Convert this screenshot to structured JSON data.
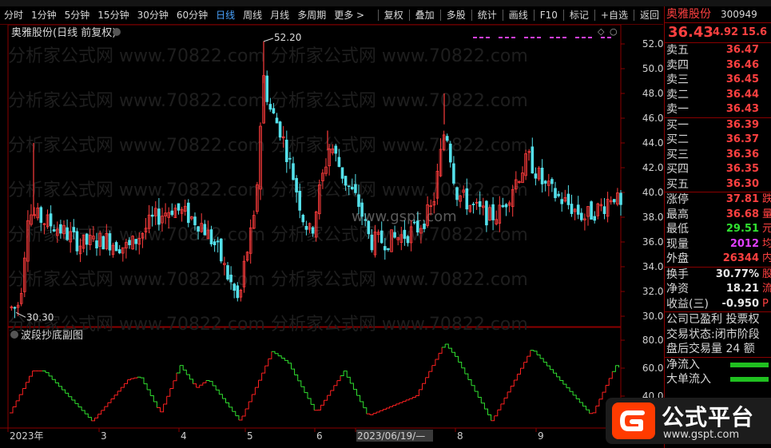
{
  "toolbar": {
    "periods": [
      "分时",
      "1分钟",
      "5分钟",
      "15分钟",
      "30分钟",
      "60分钟",
      "日线",
      "周线",
      "月线",
      "多周期",
      "更多 >"
    ],
    "active_period": "日线",
    "actions": [
      "复权",
      "叠加",
      "多股",
      "统计",
      "画线",
      "F10",
      "标记",
      "+自选",
      "返回"
    ]
  },
  "chart": {
    "title": "奥雅股份(日线 前复权)",
    "high_marker": "52.20",
    "low_marker": "30.30",
    "watermark": "www.gspt.com",
    "watermark2": "分析家公式网 www.70822.com",
    "y_ticks": [
      "52.00",
      "50.00",
      "48.00",
      "46.00",
      "44.00",
      "42.00",
      "40.00",
      "38.00",
      "36.00",
      "34.00",
      "32.00",
      "30.00"
    ],
    "indicator_title": "波段抄底副图",
    "ind_ticks": [
      "80.00",
      "60.00",
      "40.00"
    ],
    "x_labels": [
      "2023年",
      "3",
      "4",
      "5",
      "6",
      "2023/06/19/—",
      "8",
      "9"
    ],
    "colors": {
      "up": "#ff3c3c",
      "down": "#54e0ea",
      "ind_up": "#ff2020",
      "ind_down": "#30e030",
      "purple": "#e040ff",
      "grid": "#8a0000"
    }
  },
  "chart_data": {
    "type": "candlestick",
    "price_range": [
      30.0,
      52.0
    ],
    "indicator_range": [
      20,
      80
    ],
    "price_high": 52.2,
    "price_low": 30.3
  },
  "side": {
    "name": "奥雅股份",
    "code": "300949",
    "price": "36.43",
    "change": "4.92",
    "pct": "15.6",
    "asks": [
      [
        "卖五",
        "36.47"
      ],
      [
        "卖四",
        "36.46"
      ],
      [
        "卖三",
        "36.45"
      ],
      [
        "卖二",
        "36.44"
      ],
      [
        "卖一",
        "36.43"
      ]
    ],
    "bids": [
      [
        "买一",
        "36.39"
      ],
      [
        "买二",
        "36.37"
      ],
      [
        "买三",
        "36.36"
      ],
      [
        "买四",
        "36.35"
      ],
      [
        "买五",
        "36.30"
      ]
    ],
    "stats": [
      [
        "涨停",
        "37.81",
        "跌"
      ],
      [
        "最高",
        "36.68",
        "量"
      ],
      [
        "最低",
        "29.51",
        "元"
      ],
      [
        "现量",
        "2012",
        "均"
      ],
      [
        "外盘",
        "26344",
        "内"
      ]
    ],
    "stats2": [
      [
        "换手",
        "30.77%",
        "股"
      ],
      [
        "净资",
        "18.21",
        "流"
      ],
      [
        "收益(三)",
        "-0.950",
        "P"
      ]
    ],
    "notes": [
      "公司已盈利 投票权",
      "交易状态:闭市阶段",
      "盘后交易量 24 额"
    ],
    "flows": [
      "净流入",
      "大单流入"
    ]
  },
  "logo": {
    "name": "公式平台",
    "url": "www.gspt.com"
  }
}
